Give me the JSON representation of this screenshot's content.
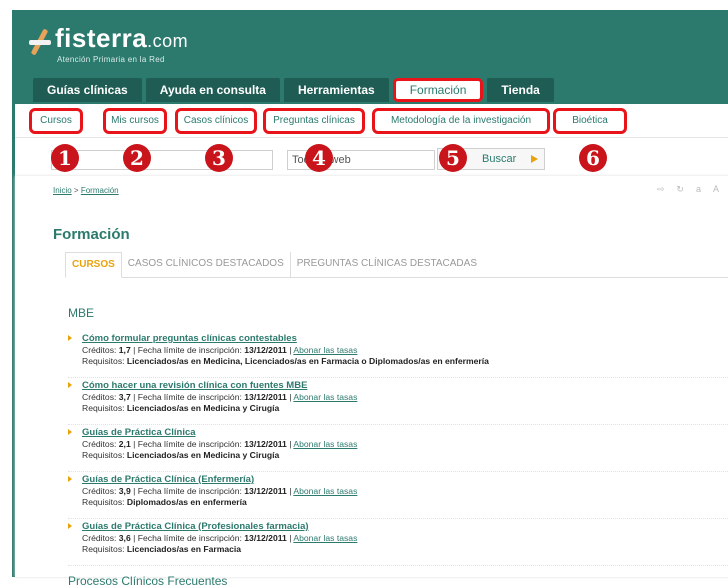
{
  "brand": {
    "name": "fisterra",
    "suffix": ".com",
    "tagline": "Atención Primaria en la Red",
    "logo_icon": "caduceus-icon"
  },
  "tabs": [
    {
      "label": "Guías clínicas",
      "active": false
    },
    {
      "label": "Ayuda en consulta",
      "active": false
    },
    {
      "label": "Herramientas",
      "active": false
    },
    {
      "label": "Formación",
      "active": true
    },
    {
      "label": "Tienda",
      "active": false
    }
  ],
  "subnav": [
    {
      "label": "Cursos",
      "badge": "1"
    },
    {
      "label": "Mis cursos",
      "badge": "2"
    },
    {
      "label": "Casos clínicos",
      "badge": "3"
    },
    {
      "label": "Preguntas clínicas",
      "badge": "4"
    },
    {
      "label": "Metodología de la investigación",
      "badge": "5"
    },
    {
      "label": "Bioética",
      "badge": "6"
    }
  ],
  "search": {
    "value": "Todo el web",
    "button_label": "Buscar"
  },
  "breadcrumb": {
    "home": "Inicio",
    "separator": ">",
    "current": "Formación"
  },
  "page": {
    "title": "Formación"
  },
  "content_tabs": [
    {
      "label": "CURSOS",
      "active": true
    },
    {
      "label": "CASOS CLÍNICOS DESTACADOS",
      "active": false
    },
    {
      "label": "PREGUNTAS CLÍNICAS DESTACADAS",
      "active": false
    }
  ],
  "labels": {
    "credits": "Créditos:",
    "deadline": "Fecha límite de inscripción:",
    "pay": "Abonar las tasas",
    "requirements": "Requisitos:"
  },
  "sections": [
    {
      "title": "MBE",
      "courses": [
        {
          "title": "Cómo formular preguntas clínicas contestables",
          "credits": "1,7",
          "deadline": "13/12/2011",
          "requirements": "Licenciados/as en Medicina, Licenciados/as en Farmacia o Diplomados/as en enfermería"
        },
        {
          "title": "Cómo hacer una revisión clínica con fuentes MBE",
          "credits": "3,7",
          "deadline": "13/12/2011",
          "requirements": "Licenciados/as en Medicina y Cirugía"
        },
        {
          "title": "Guías de Práctica Clínica",
          "credits": "2,1",
          "deadline": "13/12/2011",
          "requirements": "Licenciados/as en Medicina y Cirugía"
        },
        {
          "title": "Guías de Práctica Clínica (Enfermería)",
          "credits": "3,9",
          "deadline": "13/12/2011",
          "requirements": "Diplomados/as en enfermería"
        },
        {
          "title": "Guías de Práctica Clínica (Profesionales farmacia)",
          "credits": "3,6",
          "deadline": "13/12/2011",
          "requirements": "Licenciados/as en Farmacia"
        }
      ]
    },
    {
      "title": "Procesos Clínicos Frecuentes",
      "courses": []
    }
  ],
  "colors": {
    "brand": "#2c7a6e",
    "highlight": "#e8141a",
    "badge": "#c8141a",
    "accent": "#e8a30a"
  }
}
